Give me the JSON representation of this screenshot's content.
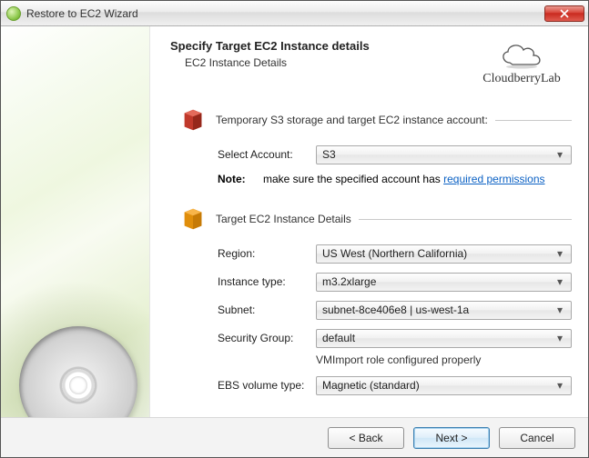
{
  "window": {
    "title": "Restore to EC2 Wizard"
  },
  "header": {
    "title": "Specify Target EC2 Instance details",
    "subtitle": "EC2 Instance Details",
    "brand": "CloudberryLab"
  },
  "section1": {
    "title": "Temporary S3 storage and target EC2 instance account:",
    "account_label": "Select Account:",
    "account_value": "S3",
    "note_label": "Note:",
    "note_text": "make sure the specified account has ",
    "note_link": "required permissions"
  },
  "section2": {
    "title": "Target EC2 Instance Details",
    "region_label": "Region:",
    "region_value": "US West (Northern California)",
    "instance_label": "Instance type:",
    "instance_value": "m3.2xlarge",
    "subnet_label": "Subnet:",
    "subnet_value": "subnet-8ce406e8 | us-west-1a",
    "sg_label": "Security Group:",
    "sg_value": "default",
    "sg_status": "VMImport role configured properly",
    "ebs_label": "EBS volume type:",
    "ebs_value": "Magnetic (standard)"
  },
  "footer": {
    "back": "< Back",
    "next": "Next >",
    "cancel": "Cancel"
  }
}
